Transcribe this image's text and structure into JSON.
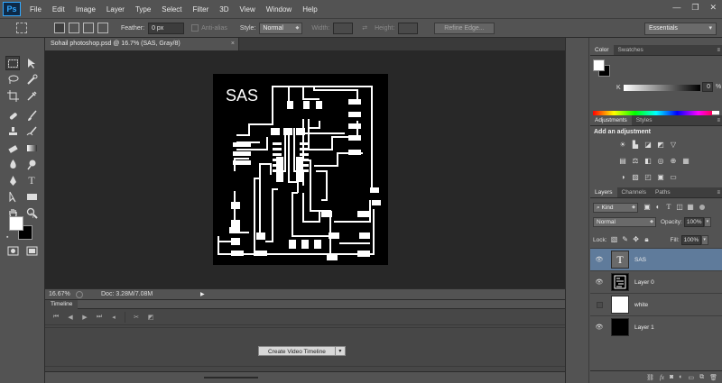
{
  "app": {
    "logo": "Ps"
  },
  "menu": [
    "File",
    "Edit",
    "Image",
    "Layer",
    "Type",
    "Select",
    "Filter",
    "3D",
    "View",
    "Window",
    "Help"
  ],
  "window_controls": {
    "minimize": "—",
    "restore": "❐",
    "close": "✕"
  },
  "options": {
    "feather_label": "Feather:",
    "feather_value": "0 px",
    "antialias_label": "Anti-alias",
    "style_label": "Style:",
    "style_value": "Normal",
    "width_label": "Width:",
    "height_label": "Height:",
    "refine_edge": "Refine Edge...",
    "workspace": "Essentials"
  },
  "document": {
    "tab_title": "Sohail photoshop.psd @ 16.7% (SAS, Gray/8)",
    "close": "×",
    "canvas_text": "SAS",
    "zoom": "16.67%",
    "doc_info": "Doc: 3.28M/7.08M"
  },
  "timeline": {
    "tab": "Timeline",
    "create_button": "Create Video Timeline"
  },
  "color_panel": {
    "tabs": [
      "Color",
      "Swatches"
    ],
    "channel_label": "K",
    "value": "0",
    "unit": "%"
  },
  "adjustments_panel": {
    "tabs": [
      "Adjustments",
      "Styles"
    ],
    "title": "Add an adjustment"
  },
  "layers_panel": {
    "tabs": [
      "Layers",
      "Channels",
      "Paths"
    ],
    "kind_label": "Kind",
    "blend_mode": "Normal",
    "opacity_label": "Opacity:",
    "opacity_value": "100%",
    "lock_label": "Lock:",
    "fill_label": "Fill:",
    "fill_value": "100%",
    "layers": [
      {
        "name": "SAS",
        "type": "text",
        "visible": true,
        "selected": true
      },
      {
        "name": "Layer 0",
        "type": "pcb",
        "visible": true,
        "selected": false
      },
      {
        "name": "white",
        "type": "white",
        "visible": false,
        "selected": false
      },
      {
        "name": "Layer 1",
        "type": "black",
        "visible": true,
        "selected": false
      }
    ],
    "footer_icons": [
      "link-icon",
      "fx-icon",
      "mask-icon",
      "adjustment-icon",
      "folder-icon",
      "new-layer-icon",
      "trash-icon"
    ]
  }
}
